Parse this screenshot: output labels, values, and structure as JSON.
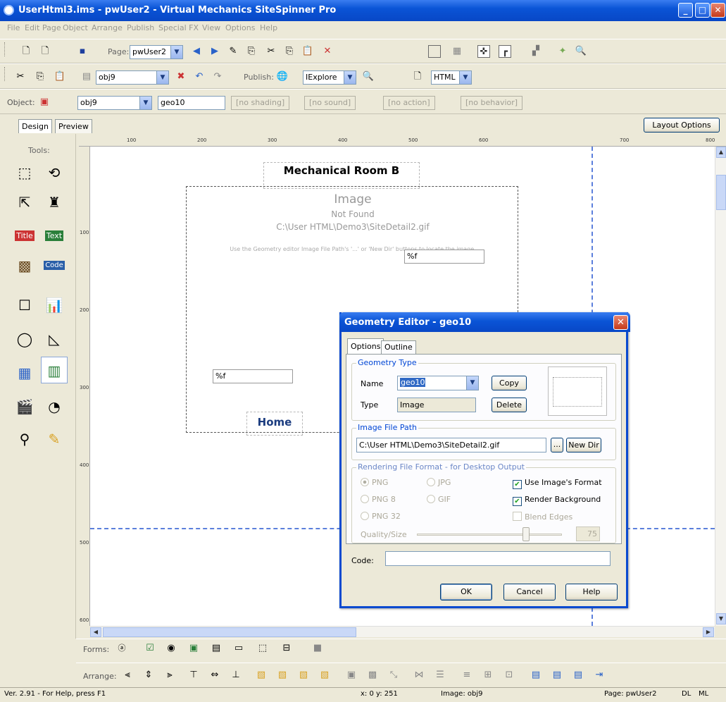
{
  "window": {
    "title": "UserHtml3.ims - pwUser2 - Virtual Mechanics SiteSpinner Pro"
  },
  "menu": [
    "File",
    "Edit",
    "Page",
    "Object",
    "Arrange",
    "Publish",
    "Special FX",
    "View",
    "Options",
    "Help"
  ],
  "toolbar1": {
    "page_label": "Page:",
    "page_value": "pwUser2"
  },
  "toolbar2": {
    "obj_value": "obj9",
    "publish_label": "Publish:",
    "browser_value": "IExplore",
    "format_value": "HTML"
  },
  "toolbar3": {
    "object_label": "Object:",
    "object_value": "obj9",
    "geo_value": "geo10",
    "shading": "[no shading]",
    "sound": "[no sound]",
    "action": "[no action]",
    "behavior": "[no behavior]"
  },
  "tabs": {
    "design": "Design",
    "preview": "Preview",
    "layout_options": "Layout Options"
  },
  "tools": {
    "label": "Tools:"
  },
  "ruler": {
    "h": [
      "100",
      "200",
      "300",
      "400",
      "500",
      "600",
      "700",
      "800"
    ],
    "v": [
      "100",
      "200",
      "300",
      "400",
      "500",
      "600",
      "700"
    ]
  },
  "canvas": {
    "heading": "Mechanical Room B",
    "image_title": "Image",
    "image_subtitle": "Not Found",
    "image_path": "C:\\User HTML\\Demo3\\SiteDetail2.gif",
    "image_hint": "Use the Geometry editor Image File Path's '...' or 'New Dir' buttons to locate the image.",
    "field1": "%f",
    "field2": "%f",
    "home_link": "Home"
  },
  "forms_bar": {
    "label": "Forms:"
  },
  "arrange_bar": {
    "label": "Arrange:"
  },
  "status": {
    "version": "Ver. 2.91 - For Help, press F1",
    "coords": "x: 0  y: 251",
    "image": "Image: obj9",
    "page": "Page: pwUser2",
    "dl": "DL",
    "ml": "ML"
  },
  "dialog": {
    "title": "Geometry Editor - geo10",
    "tabs": [
      "Options",
      "Outline"
    ],
    "geometry_type": {
      "legend": "Geometry Type",
      "name_label": "Name",
      "name_value": "geo10",
      "type_label": "Type",
      "type_value": "Image",
      "copy": "Copy",
      "delete": "Delete"
    },
    "image_file_path": {
      "legend": "Image File Path",
      "value": "C:\\User HTML\\Demo3\\SiteDetail2.gif",
      "browse": "...",
      "new_dir": "New Dir"
    },
    "rendering": {
      "legend": "Rendering File Format - for Desktop Output",
      "radios": [
        "PNG",
        "JPG",
        "PNG 8",
        "GIF",
        "PNG 32"
      ],
      "use_image_format": "Use Image's Format",
      "render_background": "Render Background",
      "blend_edges": "Blend Edges",
      "quality_label": "Quality/Size",
      "quality_value": "75",
      "quality_fraction": 0.75
    },
    "code_label": "Code:",
    "code_value": "",
    "ok": "OK",
    "cancel": "Cancel",
    "help": "Help"
  },
  "colors": {
    "titlebar": "#0a54d6",
    "guide": "#5b7fdc",
    "group_title": "#0046d5"
  }
}
